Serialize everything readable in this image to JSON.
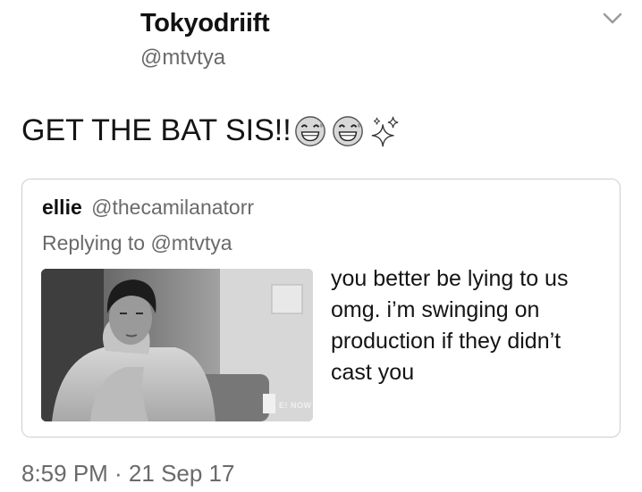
{
  "author": {
    "display_name": "Tokyodriift",
    "handle": "@mtvtya"
  },
  "menu": {
    "icon": "chevron-down-icon"
  },
  "tweet": {
    "text": "GET THE BAT SIS!!",
    "emojis": [
      "grinning-sweat-face-icon",
      "grinning-sweat-face-icon",
      "sparkles-icon"
    ]
  },
  "quoted_tweet": {
    "name": "ellie",
    "handle": "@thecamilanatorr",
    "replying_to": "Replying to @mtvtya",
    "body_lines": [
      "you better be lying to us",
      "omg. i’m swinging on",
      "production if they didn’t",
      "cast you"
    ],
    "media": {
      "watermark": "E! NOW"
    }
  },
  "timestamp": "8:59 PM · 21 Sep 17"
}
